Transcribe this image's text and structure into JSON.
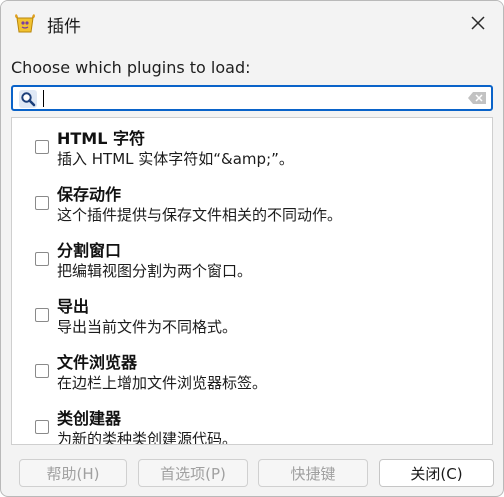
{
  "window": {
    "title": "插件",
    "icon": "pidgin-plugin-icon",
    "close_icon": "close-icon"
  },
  "prompt": "Choose which plugins to load:",
  "search": {
    "value": "",
    "placeholder": ""
  },
  "plugins": [
    {
      "name": "HTML 字符",
      "description": "插入 HTML 实体字符如“&amp;”。",
      "checked": false
    },
    {
      "name": "保存动作",
      "description": "这个插件提供与保存文件相关的不同动作。",
      "checked": false
    },
    {
      "name": "分割窗口",
      "description": "把编辑视图分割为两个窗口。",
      "checked": false
    },
    {
      "name": "导出",
      "description": "导出当前文件为不同格式。",
      "checked": false
    },
    {
      "name": "文件浏览器",
      "description": "在边栏上增加文件浏览器标签。",
      "checked": false
    },
    {
      "name": "类创建器",
      "description": "为新的类种类创建源代码。",
      "checked": false
    }
  ],
  "buttons": {
    "help": "帮助(H)",
    "preferences": "首选项(P)",
    "shortcuts": "快捷键",
    "close": "关闭(C)"
  },
  "colors": {
    "accent": "#0a63c9",
    "window_bg": "#f3f3f3",
    "list_bg": "#ffffff"
  }
}
